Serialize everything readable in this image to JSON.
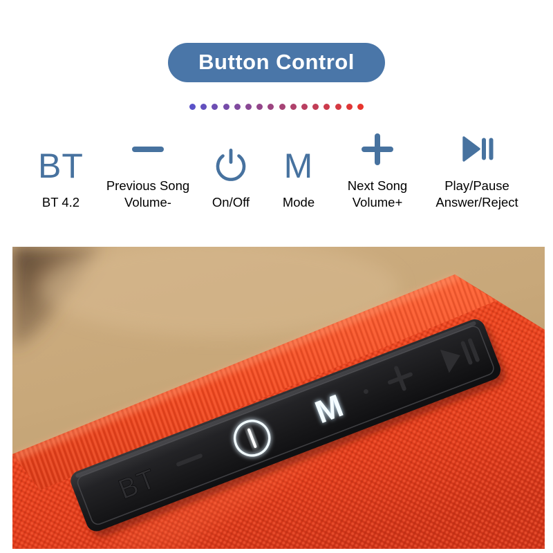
{
  "header": {
    "title": "Button Control",
    "badge_color": "#4a76a8",
    "badge_text_color": "#ffffff"
  },
  "divider": {
    "dot_count": 16,
    "start_color": "#5a52c8",
    "end_color": "#e8352d"
  },
  "icon_color": "#47729f",
  "controls": [
    {
      "icon": "bt-text-icon",
      "glyph": "BT",
      "caption_line1": "BT 4.2",
      "caption_line2": ""
    },
    {
      "icon": "minus-icon",
      "glyph": "—",
      "caption_line1": "Previous Song",
      "caption_line2": "Volume-"
    },
    {
      "icon": "power-icon",
      "glyph": "",
      "caption_line1": "On/Off",
      "caption_line2": ""
    },
    {
      "icon": "mode-text-icon",
      "glyph": "M",
      "caption_line1": "Mode",
      "caption_line2": ""
    },
    {
      "icon": "plus-icon",
      "glyph": "+",
      "caption_line1": "Next Song",
      "caption_line2": "Volume+"
    },
    {
      "icon": "play-pause-icon",
      "glyph": "",
      "caption_line1": "Play/Pause",
      "caption_line2": "Answer/Reject"
    }
  ],
  "photo": {
    "description": "Close-up of orange fabric-covered bluetooth speaker with black rubber control strip on a tan surface",
    "fabric_color": "#e8441f",
    "background_color": "#c9a878",
    "strip_color": "#1d1d1f",
    "strip_labels": [
      "BT",
      "—",
      "power",
      "M",
      "·",
      "+",
      "play-pause"
    ],
    "lit_labels": [
      "power",
      "M"
    ],
    "lit_color": "#dff0fb"
  }
}
